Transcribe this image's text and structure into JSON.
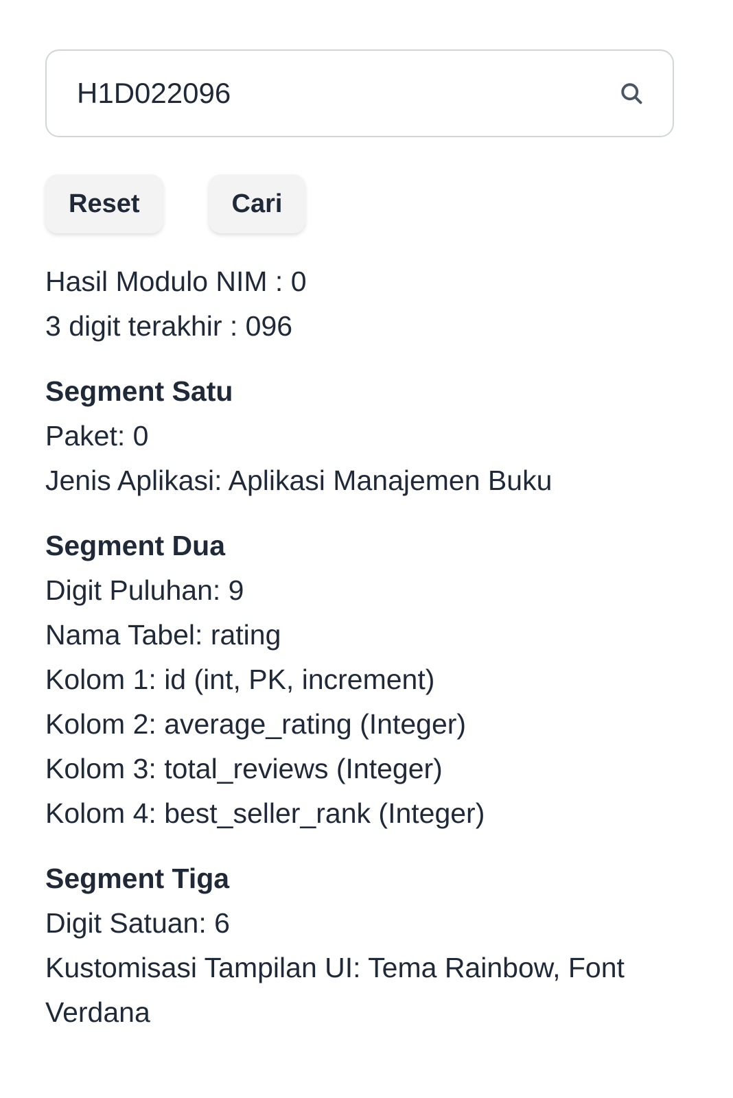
{
  "search": {
    "value": "H1D022096"
  },
  "buttons": {
    "reset_label": "Reset",
    "search_label": "Cari"
  },
  "summary": {
    "modulo": "Hasil Modulo NIM : 0",
    "last_digits": "3 digit terakhir : 096"
  },
  "segment1": {
    "title": "Segment Satu",
    "lines": [
      "Paket: 0",
      "Jenis Aplikasi: Aplikasi Manajemen Buku"
    ]
  },
  "segment2": {
    "title": "Segment Dua",
    "lines": [
      "Digit Puluhan: 9",
      "Nama Tabel: rating",
      "Kolom 1: id (int, PK, increment)",
      "Kolom 2: average_rating (Integer)",
      "Kolom 3: total_reviews (Integer)",
      "Kolom 4: best_seller_rank (Integer)"
    ]
  },
  "segment3": {
    "title": "Segment Tiga",
    "lines": [
      "Digit Satuan: 6",
      "Kustomisasi Tampilan UI: Tema Rainbow, Font Verdana"
    ]
  },
  "icons": {
    "search": "search-icon"
  },
  "colors": {
    "text": "#1f2937",
    "button_bg": "#f3f3f3",
    "border": "#d1d5db"
  }
}
